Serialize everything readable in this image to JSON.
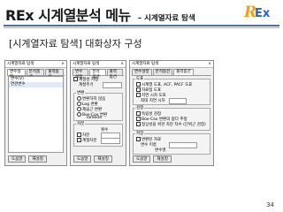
{
  "header": {
    "title": "REx 시계열분석 메뉴",
    "subtitle": "– 시계열자료 탐색"
  },
  "logo": {
    "r": "R",
    "ex": "Ex"
  },
  "slide_subtitle": "[시계열자료 탐색] 대화상자 구성",
  "page_number": "34",
  "window_title": "시계열자료 탐색",
  "close_glyph": "×",
  "tabs": [
    "변수설정",
    "분석옵션",
    "출력옵션"
  ],
  "dialog1": {
    "list_header": "변수(V)",
    "list_items": [
      "연관변수"
    ]
  },
  "dialog2": {
    "row1": "계절성 지정",
    "row2": "계절주기",
    "group_transform": "변환",
    "options": [
      "변환하지 않음",
      "Log 변환",
      "제곱근 변환",
      "Box-Cox 변환"
    ],
    "lambda_label": "lambda",
    "group_diff": "차분",
    "diff_label": "횟수",
    "diff_opts": [
      "차분",
      "계절차분"
    ]
  },
  "dialog3": {
    "group_plot": "도표",
    "plot_opts": [
      "시계열 도표, ACF, PACF 도표",
      "자료점 도표",
      "지연 시차 도표"
    ],
    "lag_label": "최대 지연 시차",
    "group_test": "검정",
    "test_opts": [
      "독립성 검정",
      "Box-Cox 변환의 람다 추정",
      "정상성을 위한 차분 차수 (단위근 검정)"
    ],
    "group_save": "저장",
    "save_opts": [
      "변환된 자료",
      "변수 이름"
    ],
    "save_name_label": "변수명"
  },
  "buttons": {
    "help": "도움말",
    "reset": "재설정"
  }
}
